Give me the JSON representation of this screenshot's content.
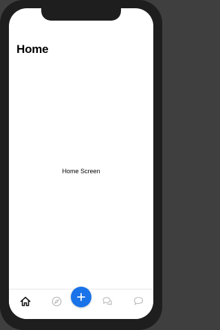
{
  "header": {
    "title": "Home"
  },
  "main": {
    "label": "Home Screen"
  },
  "colors": {
    "accent": "#1a73e8",
    "inactive_icon": "#b8b8b8",
    "active_icon": "#111111"
  },
  "tabbar": {
    "tabs": [
      {
        "icon": "home-icon",
        "active": true
      },
      {
        "icon": "compass-icon",
        "active": false
      },
      {
        "icon": "plus-icon",
        "active": false
      },
      {
        "icon": "chat-bubbles-icon",
        "active": false
      },
      {
        "icon": "chat-bubble-icon",
        "active": false
      }
    ]
  }
}
